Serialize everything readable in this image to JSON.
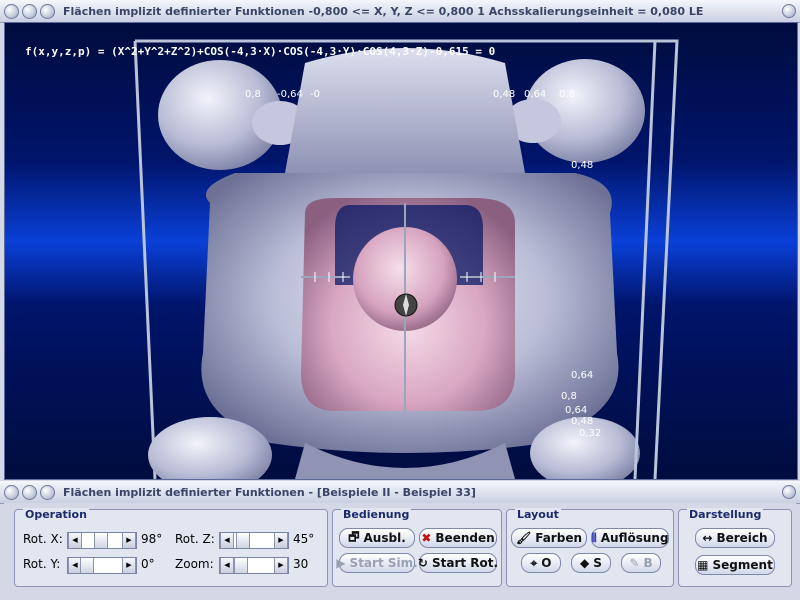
{
  "window": {
    "title": "Flächen implizit definierter Funktionen    -0,800 <= X, Y, Z <= 0,800     1 Achsskalierungseinheit = 0,080 LE"
  },
  "plot": {
    "formula": "f(x,y,z,p) = (X^2+Y^2+Z^2)+COS(-4,3·X)·COS(-4,3·Y)·COS(4,3·Z)-0,615 = 0",
    "ticks_top": [
      "0,8",
      "-0,64",
      "-0",
      "0,48",
      "0,64",
      "0,8"
    ],
    "ticks_right": [
      "0,48",
      "0,64",
      "0,8",
      "0,64",
      "0,48",
      "0,32"
    ]
  },
  "control_window": {
    "title": "Flächen implizit definierter Funktionen - [Beispiele II - Beispiel 33]"
  },
  "operation": {
    "title": "Operation",
    "rot_x_label": "Rot. X:",
    "rot_x_value": "98°",
    "rot_y_label": "Rot. Y:",
    "rot_y_value": "0°",
    "rot_z_label": "Rot. Z:",
    "rot_z_value": "45°",
    "zoom_label": "Zoom:",
    "zoom_value": "30"
  },
  "bedienung": {
    "title": "Bedienung",
    "ausbl": "Ausbl.",
    "beenden": "Beenden",
    "start_sim": "Start Sim.",
    "start_rot": "Start Rot."
  },
  "layout": {
    "title": "Layout",
    "farben": "Farben",
    "aufloesung": "Auflösung",
    "o_btn": "O",
    "s_btn": "S",
    "b_btn": "B"
  },
  "darstellung": {
    "title": "Darstellung",
    "bereich": "Bereich",
    "segment": "Segment"
  },
  "colors": {
    "surface": "#c8cbe0",
    "inner": "#e6b8d0",
    "background_dark": "#000c3e",
    "background_light": "#0a40d8"
  }
}
